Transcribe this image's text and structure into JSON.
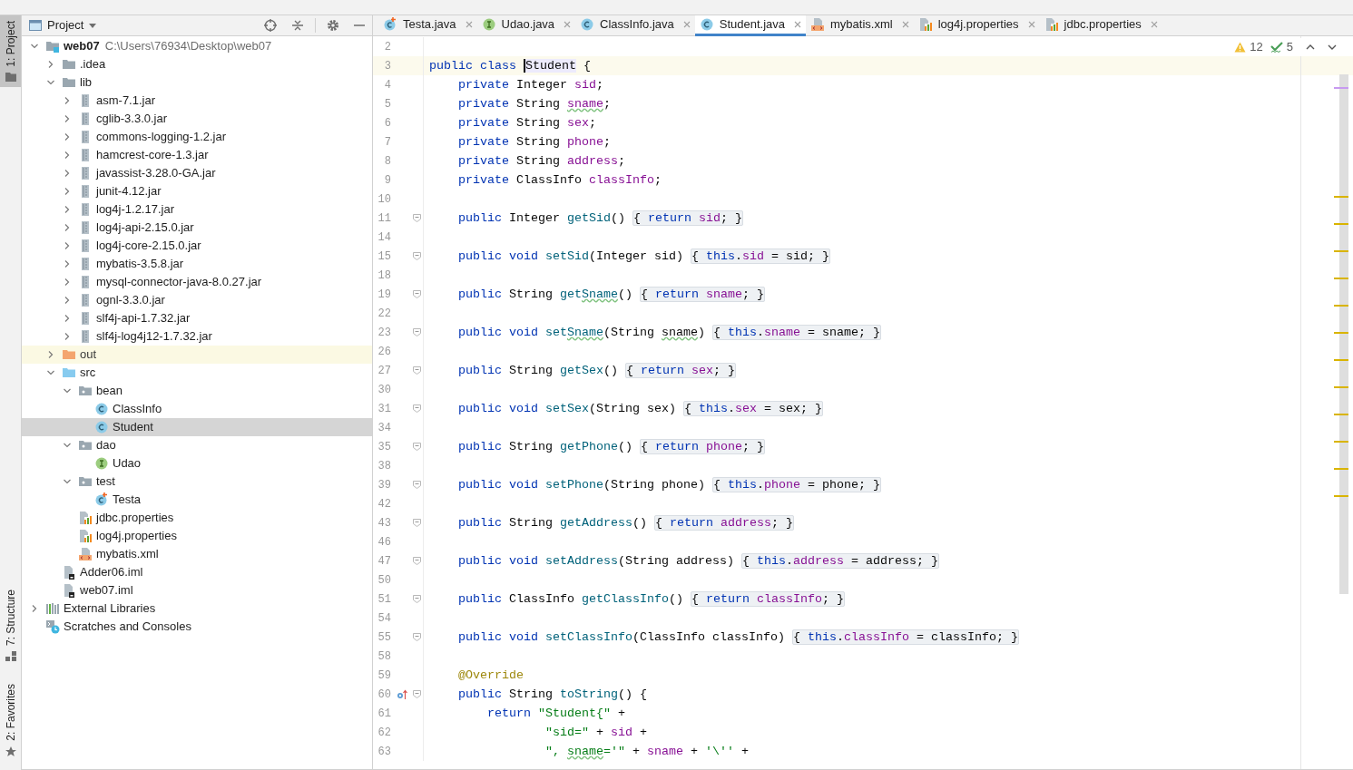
{
  "tool_strip": [
    {
      "label": "1: Project",
      "kind": "folder",
      "selected": true
    },
    {
      "label": "7: Structure",
      "kind": "structure",
      "selected": false
    },
    {
      "label": "2: Favorites",
      "kind": "star",
      "selected": false
    }
  ],
  "project_panel": {
    "title": "Project",
    "tree": [
      {
        "label": "web07",
        "path": "C:\\Users\\76934\\Desktop\\web07",
        "kind": "module",
        "expanded": true,
        "selected": false,
        "excluded": false,
        "children": [
          {
            "label": ".idea",
            "kind": "folder",
            "expanded": false,
            "selected": false,
            "excluded": false
          },
          {
            "label": "lib",
            "kind": "folder",
            "expanded": true,
            "selected": false,
            "excluded": false,
            "children": [
              {
                "label": "asm-7.1.jar",
                "kind": "jar",
                "expanded": false,
                "selected": false,
                "excluded": false
              },
              {
                "label": "cglib-3.3.0.jar",
                "kind": "jar",
                "expanded": false,
                "selected": false,
                "excluded": false
              },
              {
                "label": "commons-logging-1.2.jar",
                "kind": "jar",
                "expanded": false,
                "selected": false,
                "excluded": false
              },
              {
                "label": "hamcrest-core-1.3.jar",
                "kind": "jar",
                "expanded": false,
                "selected": false,
                "excluded": false
              },
              {
                "label": "javassist-3.28.0-GA.jar",
                "kind": "jar",
                "expanded": false,
                "selected": false,
                "excluded": false
              },
              {
                "label": "junit-4.12.jar",
                "kind": "jar",
                "expanded": false,
                "selected": false,
                "excluded": false
              },
              {
                "label": "log4j-1.2.17.jar",
                "kind": "jar",
                "expanded": false,
                "selected": false,
                "excluded": false
              },
              {
                "label": "log4j-api-2.15.0.jar",
                "kind": "jar",
                "expanded": false,
                "selected": false,
                "excluded": false
              },
              {
                "label": "log4j-core-2.15.0.jar",
                "kind": "jar",
                "expanded": false,
                "selected": false,
                "excluded": false
              },
              {
                "label": "mybatis-3.5.8.jar",
                "kind": "jar",
                "expanded": false,
                "selected": false,
                "excluded": false
              },
              {
                "label": "mysql-connector-java-8.0.27.jar",
                "kind": "jar",
                "expanded": false,
                "selected": false,
                "excluded": false
              },
              {
                "label": "ognl-3.3.0.jar",
                "kind": "jar",
                "expanded": false,
                "selected": false,
                "excluded": false
              },
              {
                "label": "slf4j-api-1.7.32.jar",
                "kind": "jar",
                "expanded": false,
                "selected": false,
                "excluded": false
              },
              {
                "label": "slf4j-log4j12-1.7.32.jar",
                "kind": "jar",
                "expanded": false,
                "selected": false,
                "excluded": false
              }
            ]
          },
          {
            "label": "out",
            "kind": "folder_out",
            "expanded": false,
            "selected": false,
            "excluded": true
          },
          {
            "label": "src",
            "kind": "folder_src",
            "expanded": true,
            "selected": false,
            "excluded": false,
            "children": [
              {
                "label": "bean",
                "kind": "package",
                "expanded": true,
                "selected": false,
                "excluded": false,
                "children": [
                  {
                    "label": "ClassInfo",
                    "kind": "class",
                    "selected": false,
                    "excluded": false
                  },
                  {
                    "label": "Student",
                    "kind": "class",
                    "selected": true,
                    "excluded": false
                  }
                ]
              },
              {
                "label": "dao",
                "kind": "package",
                "expanded": true,
                "selected": false,
                "excluded": false,
                "children": [
                  {
                    "label": "Udao",
                    "kind": "interface",
                    "selected": false,
                    "excluded": false
                  }
                ]
              },
              {
                "label": "test",
                "kind": "package",
                "expanded": true,
                "selected": false,
                "excluded": false,
                "children": [
                  {
                    "label": "Testa",
                    "kind": "class_run",
                    "selected": false,
                    "excluded": false
                  }
                ]
              },
              {
                "label": "jdbc.properties",
                "kind": "properties",
                "selected": false,
                "excluded": false
              },
              {
                "label": "log4j.properties",
                "kind": "properties",
                "selected": false,
                "excluded": false
              },
              {
                "label": "mybatis.xml",
                "kind": "xml",
                "selected": false,
                "excluded": false
              }
            ]
          },
          {
            "label": "Adder06.iml",
            "kind": "iml",
            "selected": false,
            "excluded": false
          },
          {
            "label": "web07.iml",
            "kind": "iml",
            "selected": false,
            "excluded": false
          }
        ]
      },
      {
        "label": "External Libraries",
        "kind": "libraries",
        "expanded": false,
        "selected": false,
        "excluded": false
      },
      {
        "label": "Scratches and Consoles",
        "kind": "scratches",
        "selected": false,
        "excluded": false
      }
    ]
  },
  "tabs": [
    {
      "label": "Testa.java",
      "kind": "class_run",
      "selected": false
    },
    {
      "label": "Udao.java",
      "kind": "interface",
      "selected": false
    },
    {
      "label": "ClassInfo.java",
      "kind": "class",
      "selected": false
    },
    {
      "label": "Student.java",
      "kind": "class",
      "selected": true
    },
    {
      "label": "mybatis.xml",
      "kind": "xml",
      "selected": false
    },
    {
      "label": "log4j.properties",
      "kind": "properties",
      "selected": false
    },
    {
      "label": "jdbc.properties",
      "kind": "properties",
      "selected": false
    }
  ],
  "inspections": {
    "warnings": "12",
    "weak_warnings": "5"
  },
  "code_lines": [
    {
      "n": "2",
      "current": false,
      "fold": false
    },
    {
      "n": "3",
      "current": true,
      "fold": false,
      "parts": [
        {
          "text": "public class ",
          "kind": "kw"
        },
        {
          "text": "Student",
          "kind": "caret_hl"
        },
        {
          "text": " {",
          "kind": "plain"
        }
      ]
    },
    {
      "n": "4",
      "current": false,
      "fold": false,
      "parts": [
        {
          "text": "    private ",
          "kind": "kw"
        },
        {
          "text": "Integer ",
          "kind": "plain"
        },
        {
          "text": "sid",
          "kind": "field"
        },
        {
          "text": ";",
          "kind": "plain"
        }
      ]
    },
    {
      "n": "5",
      "current": false,
      "fold": false,
      "parts": [
        {
          "text": "    private ",
          "kind": "kw"
        },
        {
          "text": "String ",
          "kind": "plain"
        },
        {
          "text": "sname",
          "kind": "field_typo"
        },
        {
          "text": ";",
          "kind": "plain"
        }
      ]
    },
    {
      "n": "6",
      "current": false,
      "fold": false,
      "parts": [
        {
          "text": "    private ",
          "kind": "kw"
        },
        {
          "text": "String ",
          "kind": "plain"
        },
        {
          "text": "sex",
          "kind": "field"
        },
        {
          "text": ";",
          "kind": "plain"
        }
      ]
    },
    {
      "n": "7",
      "current": false,
      "fold": false,
      "parts": [
        {
          "text": "    private ",
          "kind": "kw"
        },
        {
          "text": "String ",
          "kind": "plain"
        },
        {
          "text": "phone",
          "kind": "field"
        },
        {
          "text": ";",
          "kind": "plain"
        }
      ]
    },
    {
      "n": "8",
      "current": false,
      "fold": false,
      "parts": [
        {
          "text": "    private ",
          "kind": "kw"
        },
        {
          "text": "String ",
          "kind": "plain"
        },
        {
          "text": "address",
          "kind": "field"
        },
        {
          "text": ";",
          "kind": "plain"
        }
      ]
    },
    {
      "n": "9",
      "current": false,
      "fold": false,
      "parts": [
        {
          "text": "    private ",
          "kind": "kw"
        },
        {
          "text": "ClassInfo ",
          "kind": "plain"
        },
        {
          "text": "classInfo",
          "kind": "field"
        },
        {
          "text": ";",
          "kind": "plain"
        }
      ]
    },
    {
      "n": "10",
      "current": false,
      "fold": false
    },
    {
      "n": "11",
      "current": false,
      "fold": true,
      "parts": [
        {
          "text": "    public ",
          "kind": "kw"
        },
        {
          "text": "Integer ",
          "kind": "plain"
        },
        {
          "text": "getSid",
          "kind": "method"
        },
        {
          "text": "() ",
          "kind": "plain"
        },
        {
          "kind": "folded",
          "parts": [
            {
              "text": "{ ",
              "kind": "plain"
            },
            {
              "text": "return ",
              "kind": "kw"
            },
            {
              "text": "sid",
              "kind": "field"
            },
            {
              "text": "; }",
              "kind": "plain"
            }
          ]
        }
      ]
    },
    {
      "n": "14",
      "current": false,
      "fold": false
    },
    {
      "n": "15",
      "current": false,
      "fold": true,
      "parts": [
        {
          "text": "    public void ",
          "kind": "kw"
        },
        {
          "text": "setSid",
          "kind": "method"
        },
        {
          "text": "(Integer sid) ",
          "kind": "plain"
        },
        {
          "kind": "folded",
          "parts": [
            {
              "text": "{ ",
              "kind": "plain"
            },
            {
              "text": "this",
              "kind": "kw"
            },
            {
              "text": ".",
              "kind": "plain"
            },
            {
              "text": "sid",
              "kind": "field"
            },
            {
              "text": " = sid; }",
              "kind": "plain"
            }
          ]
        }
      ]
    },
    {
      "n": "18",
      "current": false,
      "fold": false
    },
    {
      "n": "19",
      "current": false,
      "fold": true,
      "parts": [
        {
          "text": "    public ",
          "kind": "kw"
        },
        {
          "text": "String ",
          "kind": "plain"
        },
        {
          "text": "get",
          "kind": "method"
        },
        {
          "text": "Sname",
          "kind": "method_typo"
        },
        {
          "text": "() ",
          "kind": "plain"
        },
        {
          "kind": "folded",
          "parts": [
            {
              "text": "{ ",
              "kind": "plain"
            },
            {
              "text": "return ",
              "kind": "kw"
            },
            {
              "text": "sname",
              "kind": "field"
            },
            {
              "text": "; }",
              "kind": "plain"
            }
          ]
        }
      ]
    },
    {
      "n": "22",
      "current": false,
      "fold": false
    },
    {
      "n": "23",
      "current": false,
      "fold": true,
      "parts": [
        {
          "text": "    public void ",
          "kind": "kw"
        },
        {
          "text": "set",
          "kind": "method"
        },
        {
          "text": "Sname",
          "kind": "method_typo"
        },
        {
          "text": "(String ",
          "kind": "plain"
        },
        {
          "text": "sname",
          "kind": "plain_typo"
        },
        {
          "text": ") ",
          "kind": "plain"
        },
        {
          "kind": "folded",
          "parts": [
            {
              "text": "{ ",
              "kind": "plain"
            },
            {
              "text": "this",
              "kind": "kw"
            },
            {
              "text": ".",
              "kind": "plain"
            },
            {
              "text": "sname",
              "kind": "field"
            },
            {
              "text": " = sname; }",
              "kind": "plain"
            }
          ]
        }
      ]
    },
    {
      "n": "26",
      "current": false,
      "fold": false
    },
    {
      "n": "27",
      "current": false,
      "fold": true,
      "parts": [
        {
          "text": "    public ",
          "kind": "kw"
        },
        {
          "text": "String ",
          "kind": "plain"
        },
        {
          "text": "getSex",
          "kind": "method"
        },
        {
          "text": "() ",
          "kind": "plain"
        },
        {
          "kind": "folded",
          "parts": [
            {
              "text": "{ ",
              "kind": "plain"
            },
            {
              "text": "return ",
              "kind": "kw"
            },
            {
              "text": "sex",
              "kind": "field"
            },
            {
              "text": "; }",
              "kind": "plain"
            }
          ]
        }
      ]
    },
    {
      "n": "30",
      "current": false,
      "fold": false
    },
    {
      "n": "31",
      "current": false,
      "fold": true,
      "parts": [
        {
          "text": "    public void ",
          "kind": "kw"
        },
        {
          "text": "setSex",
          "kind": "method"
        },
        {
          "text": "(String sex) ",
          "kind": "plain"
        },
        {
          "kind": "folded",
          "parts": [
            {
              "text": "{ ",
              "kind": "plain"
            },
            {
              "text": "this",
              "kind": "kw"
            },
            {
              "text": ".",
              "kind": "plain"
            },
            {
              "text": "sex",
              "kind": "field"
            },
            {
              "text": " = sex; }",
              "kind": "plain"
            }
          ]
        }
      ]
    },
    {
      "n": "34",
      "current": false,
      "fold": false
    },
    {
      "n": "35",
      "current": false,
      "fold": true,
      "parts": [
        {
          "text": "    public ",
          "kind": "kw"
        },
        {
          "text": "String ",
          "kind": "plain"
        },
        {
          "text": "getPhone",
          "kind": "method"
        },
        {
          "text": "() ",
          "kind": "plain"
        },
        {
          "kind": "folded",
          "parts": [
            {
              "text": "{ ",
              "kind": "plain"
            },
            {
              "text": "return ",
              "kind": "kw"
            },
            {
              "text": "phone",
              "kind": "field"
            },
            {
              "text": "; }",
              "kind": "plain"
            }
          ]
        }
      ]
    },
    {
      "n": "38",
      "current": false,
      "fold": false
    },
    {
      "n": "39",
      "current": false,
      "fold": true,
      "parts": [
        {
          "text": "    public void ",
          "kind": "kw"
        },
        {
          "text": "setPhone",
          "kind": "method"
        },
        {
          "text": "(String phone) ",
          "kind": "plain"
        },
        {
          "kind": "folded",
          "parts": [
            {
              "text": "{ ",
              "kind": "plain"
            },
            {
              "text": "this",
              "kind": "kw"
            },
            {
              "text": ".",
              "kind": "plain"
            },
            {
              "text": "phone",
              "kind": "field"
            },
            {
              "text": " = phone; }",
              "kind": "plain"
            }
          ]
        }
      ]
    },
    {
      "n": "42",
      "current": false,
      "fold": false
    },
    {
      "n": "43",
      "current": false,
      "fold": true,
      "parts": [
        {
          "text": "    public ",
          "kind": "kw"
        },
        {
          "text": "String ",
          "kind": "plain"
        },
        {
          "text": "getAddress",
          "kind": "method"
        },
        {
          "text": "() ",
          "kind": "plain"
        },
        {
          "kind": "folded",
          "parts": [
            {
              "text": "{ ",
              "kind": "plain"
            },
            {
              "text": "return ",
              "kind": "kw"
            },
            {
              "text": "address",
              "kind": "field"
            },
            {
              "text": "; }",
              "kind": "plain"
            }
          ]
        }
      ]
    },
    {
      "n": "46",
      "current": false,
      "fold": false
    },
    {
      "n": "47",
      "current": false,
      "fold": true,
      "parts": [
        {
          "text": "    public void ",
          "kind": "kw"
        },
        {
          "text": "setAddress",
          "kind": "method"
        },
        {
          "text": "(String address) ",
          "kind": "plain"
        },
        {
          "kind": "folded",
          "parts": [
            {
              "text": "{ ",
              "kind": "plain"
            },
            {
              "text": "this",
              "kind": "kw"
            },
            {
              "text": ".",
              "kind": "plain"
            },
            {
              "text": "address",
              "kind": "field"
            },
            {
              "text": " = address; }",
              "kind": "plain"
            }
          ]
        }
      ]
    },
    {
      "n": "50",
      "current": false,
      "fold": false
    },
    {
      "n": "51",
      "current": false,
      "fold": true,
      "parts": [
        {
          "text": "    public ",
          "kind": "kw"
        },
        {
          "text": "ClassInfo ",
          "kind": "plain"
        },
        {
          "text": "getClassInfo",
          "kind": "method"
        },
        {
          "text": "() ",
          "kind": "plain"
        },
        {
          "kind": "folded",
          "parts": [
            {
              "text": "{ ",
              "kind": "plain"
            },
            {
              "text": "return ",
              "kind": "kw"
            },
            {
              "text": "classInfo",
              "kind": "field"
            },
            {
              "text": "; }",
              "kind": "plain"
            }
          ]
        }
      ]
    },
    {
      "n": "54",
      "current": false,
      "fold": false
    },
    {
      "n": "55",
      "current": false,
      "fold": true,
      "parts": [
        {
          "text": "    public void ",
          "kind": "kw"
        },
        {
          "text": "setClassInfo",
          "kind": "method"
        },
        {
          "text": "(ClassInfo classInfo) ",
          "kind": "plain"
        },
        {
          "kind": "folded",
          "parts": [
            {
              "text": "{ ",
              "kind": "plain"
            },
            {
              "text": "this",
              "kind": "kw"
            },
            {
              "text": ".",
              "kind": "plain"
            },
            {
              "text": "classInfo",
              "kind": "field"
            },
            {
              "text": " = classInfo; }",
              "kind": "plain"
            }
          ]
        }
      ]
    },
    {
      "n": "58",
      "current": false,
      "fold": false
    },
    {
      "n": "59",
      "current": false,
      "fold": false,
      "parts": [
        {
          "text": "    @Override",
          "kind": "ann"
        }
      ]
    },
    {
      "n": "60",
      "current": false,
      "fold": true,
      "gutter_icon": {
        "kind": "override"
      },
      "parts": [
        {
          "text": "    public ",
          "kind": "kw"
        },
        {
          "text": "String ",
          "kind": "plain"
        },
        {
          "text": "toString",
          "kind": "method"
        },
        {
          "text": "() {",
          "kind": "plain"
        }
      ]
    },
    {
      "n": "61",
      "current": false,
      "fold": false,
      "parts": [
        {
          "text": "        return ",
          "kind": "kw"
        },
        {
          "text": "\"Student{\"",
          "kind": "str"
        },
        {
          "text": " +",
          "kind": "plain"
        }
      ]
    },
    {
      "n": "62",
      "current": false,
      "fold": false,
      "parts": [
        {
          "text": "                \"sid=\"",
          "kind": "str"
        },
        {
          "text": " + ",
          "kind": "plain"
        },
        {
          "text": "sid",
          "kind": "field"
        },
        {
          "text": " +",
          "kind": "plain"
        }
      ]
    },
    {
      "n": "63",
      "current": false,
      "fold": false,
      "parts": [
        {
          "text": "                \", ",
          "kind": "str"
        },
        {
          "text": "sname",
          "kind": "str_typo"
        },
        {
          "text": "='\"",
          "kind": "str"
        },
        {
          "text": " + ",
          "kind": "plain"
        },
        {
          "text": "sname",
          "kind": "field"
        },
        {
          "text": " + ",
          "kind": "plain"
        },
        {
          "text": "'\\''",
          "kind": "str"
        },
        {
          "text": " +",
          "kind": "plain"
        }
      ]
    }
  ]
}
